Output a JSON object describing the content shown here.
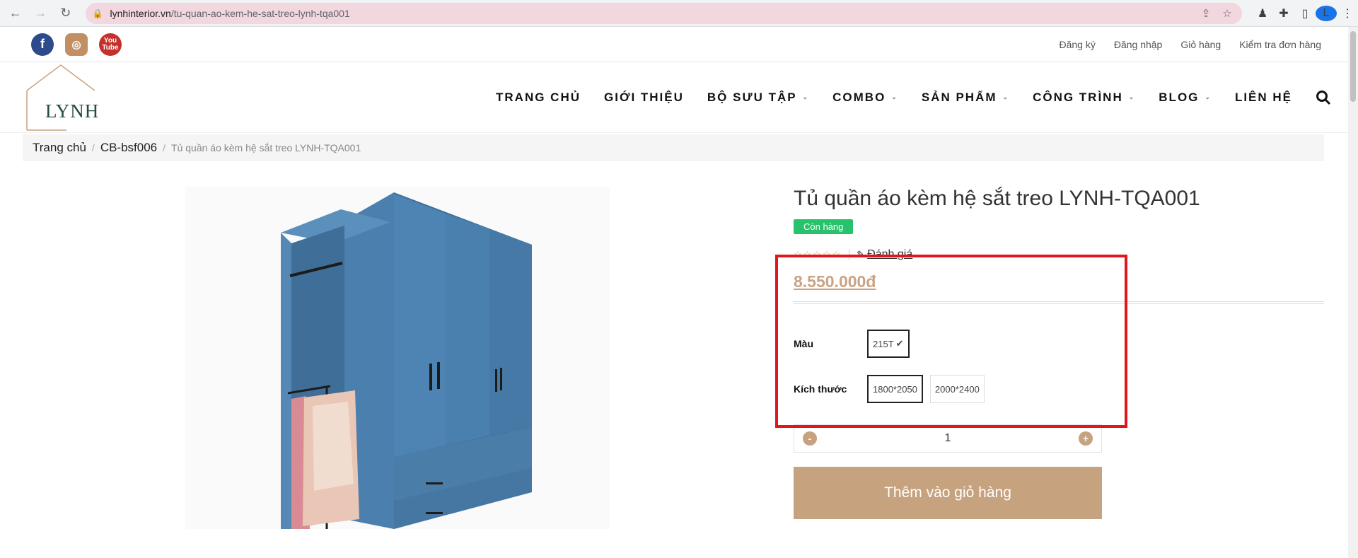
{
  "browser": {
    "url_host": "lynhinterior.vn",
    "url_path": "/tu-quan-ao-kem-he-sat-treo-lynh-tqa001",
    "profile_initial": "L"
  },
  "topbar": {
    "links": [
      "Đăng ký",
      "Đăng nhập",
      "Giỏ hàng",
      "Kiểm tra đơn hàng"
    ]
  },
  "logo": {
    "text": "LYNH"
  },
  "nav": {
    "items": [
      {
        "label": "TRANG CHỦ",
        "dropdown": false
      },
      {
        "label": "GIỚI THIỆU",
        "dropdown": false
      },
      {
        "label": "BỘ SƯU TẬP",
        "dropdown": true
      },
      {
        "label": "COMBO",
        "dropdown": true
      },
      {
        "label": "SẢN PHẨM",
        "dropdown": true
      },
      {
        "label": "CÔNG TRÌNH",
        "dropdown": true
      },
      {
        "label": "BLOG",
        "dropdown": true
      },
      {
        "label": "LIÊN HỆ",
        "dropdown": false
      }
    ]
  },
  "breadcrumb": {
    "home": "Trang chủ",
    "category": "CB-bsf006",
    "current": "Tủ quần áo kèm hệ sắt treo LYNH-TQA001"
  },
  "product": {
    "title": "Tủ quần áo kèm hệ sắt treo LYNH-TQA001",
    "stock": "Còn hàng",
    "stars": "☆☆☆☆☆",
    "review_label": "Đánh giá",
    "price": "8.550.000đ",
    "color_label": "Màu",
    "colors": [
      "215T"
    ],
    "size_label": "Kích thước",
    "sizes": [
      "1800*2050",
      "2000*2400"
    ],
    "quantity": "1",
    "add_to_cart": "Thêm vào giỏ hàng"
  },
  "colors": {
    "accent": "#c6a27f",
    "stock_badge": "#27c26b",
    "highlight": "#e0161e",
    "wardrobe": "#4a7ca6"
  }
}
